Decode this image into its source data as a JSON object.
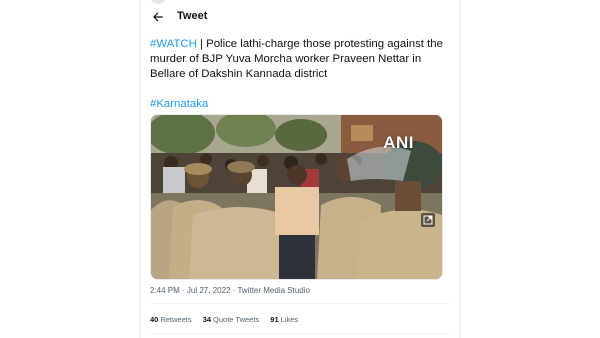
{
  "header": {
    "title": "Tweet",
    "back_icon": "arrow-left-icon"
  },
  "tweet": {
    "hashtag_watch": "#WATCH",
    "body": " | Police lathi-charge those protesting against the murder of BJP Yuva Morcha worker Praveen Nettar in Bellare of Dakshin Kannada district",
    "hashtag_karnataka": "#Karnataka",
    "media": {
      "watermark": "ANI",
      "expand_icon": "expand-icon"
    },
    "meta": {
      "time": "2:44 PM",
      "sep1": " · ",
      "date": "Jul 27, 2022",
      "sep2": " · ",
      "source": "Twitter Media Studio"
    },
    "stats": {
      "retweets_count": "40",
      "retweets_label": "Retweets",
      "quote_count": "34",
      "quote_label": "Quote Tweets",
      "likes_count": "91",
      "likes_label": "Likes"
    }
  },
  "colors": {
    "text": "#0f1419",
    "secondary": "#536471",
    "link": "#1d9bf0",
    "border": "#eff3f4"
  }
}
